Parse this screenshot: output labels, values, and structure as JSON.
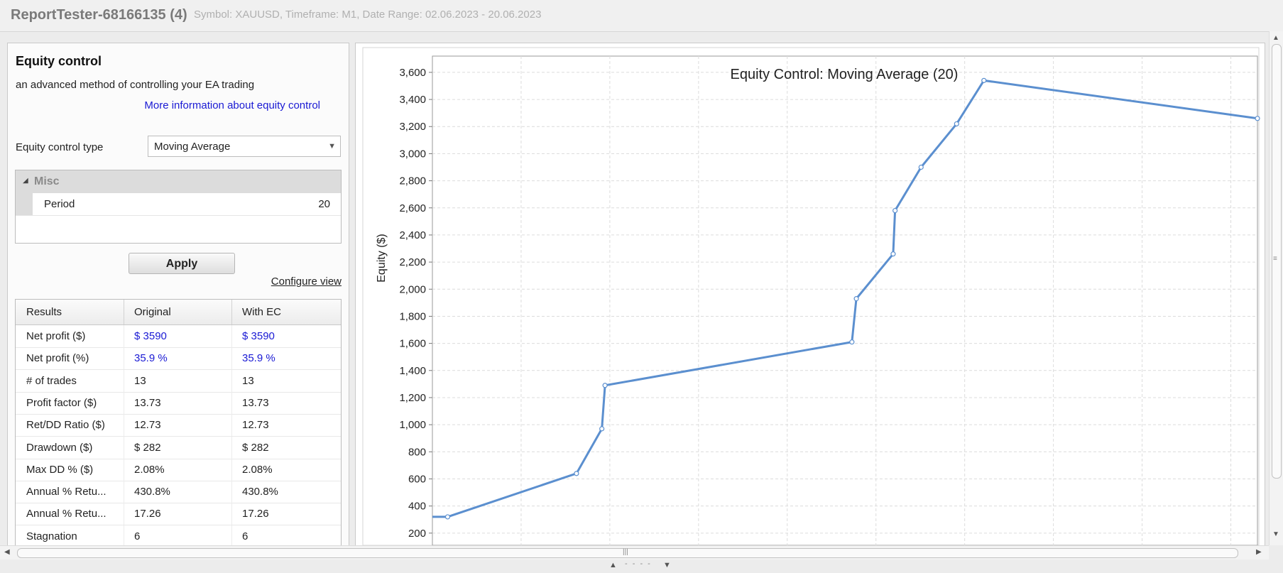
{
  "window": {
    "title": "ReportTester-68166135 (4)",
    "subtitle": "Symbol: XAUUSD, Timeframe: M1, Date Range: 02.06.2023 - 20.06.2023"
  },
  "equity_panel": {
    "title": "Equity control",
    "description": "an advanced method of controlling your EA trading",
    "info_link": "More information about equity control",
    "type_label": "Equity control type",
    "type_value": "Moving Average",
    "misc_category": "Misc",
    "period_label": "Period",
    "period_value": "20",
    "apply_label": "Apply",
    "configure_view_label": "Configure view"
  },
  "results": {
    "headers": [
      "Results",
      "Original",
      "With EC"
    ],
    "rows": [
      {
        "metric": "Net profit ($)",
        "original": "$ 3590",
        "with_ec": "$ 3590",
        "highlight": true
      },
      {
        "metric": "Net profit (%)",
        "original": "35.9 %",
        "with_ec": "35.9 %",
        "highlight": true
      },
      {
        "metric": "# of trades",
        "original": "13",
        "with_ec": "13",
        "highlight": false
      },
      {
        "metric": "Profit factor ($)",
        "original": "13.73",
        "with_ec": "13.73",
        "highlight": false
      },
      {
        "metric": "Ret/DD Ratio ($)",
        "original": "12.73",
        "with_ec": "12.73",
        "highlight": false
      },
      {
        "metric": "Drawdown ($)",
        "original": "$ 282",
        "with_ec": "$ 282",
        "highlight": false
      },
      {
        "metric": "Max DD % ($)",
        "original": "2.08%",
        "with_ec": "2.08%",
        "highlight": false
      },
      {
        "metric": "Annual % Retu...",
        "original": "430.8%",
        "with_ec": "430.8%",
        "highlight": false
      },
      {
        "metric": "Annual % Retu...",
        "original": "17.26",
        "with_ec": "17.26",
        "highlight": false
      },
      {
        "metric": "Stagnation",
        "original": "6",
        "with_ec": "6",
        "highlight": false
      }
    ],
    "link_color": "#1a1ad4"
  },
  "chart_data": {
    "type": "line",
    "title": "Equity Control: Moving Average (20)",
    "xlabel": "",
    "ylabel": "Equity ($)",
    "ylim": [
      110,
      3720
    ],
    "yticks": [
      200,
      400,
      600,
      800,
      1000,
      1200,
      1400,
      1600,
      1800,
      2000,
      2200,
      2400,
      2600,
      2800,
      3000,
      3200,
      3400,
      3600
    ],
    "ytick_labels": [
      "200",
      "400",
      "600",
      "800",
      "1,000",
      "1,200",
      "1,400",
      "1,600",
      "1,800",
      "2,000",
      "2,200",
      "2,400",
      "2,600",
      "2,800",
      "3,000",
      "3,200",
      "3,400",
      "3,600"
    ],
    "xlim": [
      0,
      13
    ],
    "grid": true,
    "series": [
      {
        "color": "#5b8fcf",
        "x": [
          0,
          0.24,
          2.27,
          2.67,
          2.72,
          6.61,
          6.68,
          7.26,
          7.29,
          7.7,
          8.26,
          8.69,
          13
        ],
        "y": [
          320,
          320,
          640,
          970,
          1290,
          1610,
          1930,
          2260,
          2580,
          2900,
          3220,
          3540,
          3260
        ]
      }
    ]
  }
}
